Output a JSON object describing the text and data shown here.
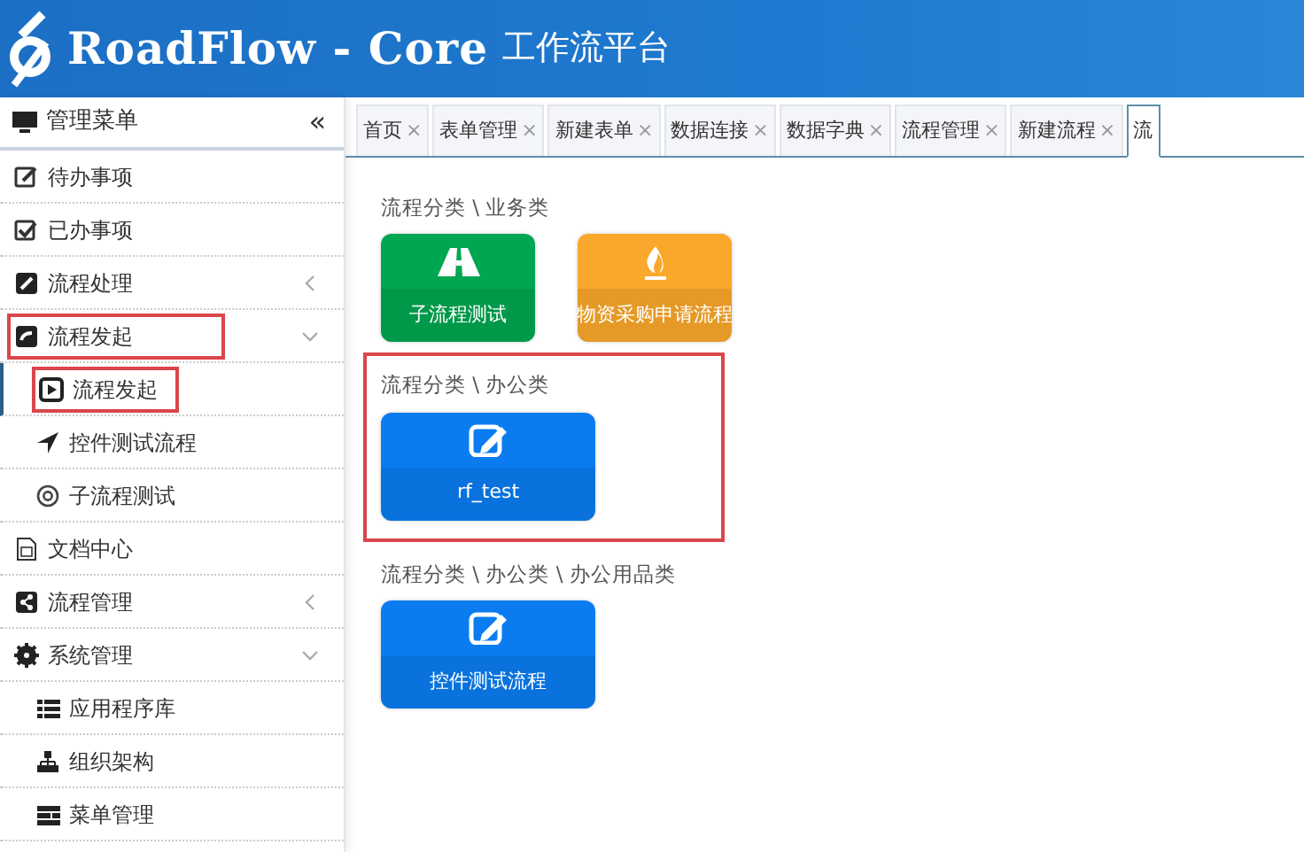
{
  "header": {
    "brand": "RoadFlow - Core",
    "subtitle": "工作流平台"
  },
  "sidebar": {
    "title": "管理菜单",
    "collapse": "«",
    "items": [
      {
        "label": "待办事项",
        "selected": false,
        "highlighted": false
      },
      {
        "label": "已办事项",
        "selected": false,
        "highlighted": false
      },
      {
        "label": "流程处理",
        "selected": false,
        "highlighted": false,
        "expanded": false
      },
      {
        "label": "流程发起",
        "selected": false,
        "highlighted": true,
        "expanded": true,
        "children": [
          {
            "label": "流程发起",
            "selected": true,
            "highlighted": true
          },
          {
            "label": "控件测试流程",
            "selected": false,
            "highlighted": false
          },
          {
            "label": "子流程测试",
            "selected": false,
            "highlighted": false
          }
        ]
      },
      {
        "label": "文档中心",
        "selected": false,
        "highlighted": false
      },
      {
        "label": "流程管理",
        "selected": false,
        "highlighted": false,
        "expanded": false
      },
      {
        "label": "系统管理",
        "selected": false,
        "highlighted": false,
        "expanded": true,
        "children": [
          {
            "label": "应用程序库",
            "selected": false,
            "highlighted": false
          },
          {
            "label": "组织架构",
            "selected": false,
            "highlighted": false
          },
          {
            "label": "菜单管理",
            "selected": false,
            "highlighted": false
          }
        ]
      }
    ]
  },
  "tabs": [
    {
      "label": "首页",
      "close": "×",
      "selected": false
    },
    {
      "label": "表单管理",
      "close": "×",
      "selected": false
    },
    {
      "label": "新建表单",
      "close": "×",
      "selected": false
    },
    {
      "label": "数据连接",
      "close": "×",
      "selected": false
    },
    {
      "label": "数据字典",
      "close": "×",
      "selected": false
    },
    {
      "label": "流程管理",
      "close": "×",
      "selected": false
    },
    {
      "label": "新建流程",
      "close": "×",
      "selected": false
    },
    {
      "label": "流",
      "selected": true
    }
  ],
  "groups": [
    {
      "title": "流程分类 \\ 业务类",
      "highlighted": false,
      "cards": [
        {
          "label": "子流程测试",
          "color": "#00a651"
        },
        {
          "label": "物资采购申请流程",
          "color": "#f9a82b"
        }
      ]
    },
    {
      "title": "流程分类 \\ 办公类",
      "highlighted": true,
      "cards": [
        {
          "label": "rf_test",
          "color": "#0a7cf0"
        }
      ]
    },
    {
      "title": "流程分类 \\ 办公类 \\ 办公用品类",
      "highlighted": false,
      "cards": [
        {
          "label": "控件测试流程",
          "color": "#0a7cf0"
        }
      ]
    }
  ]
}
